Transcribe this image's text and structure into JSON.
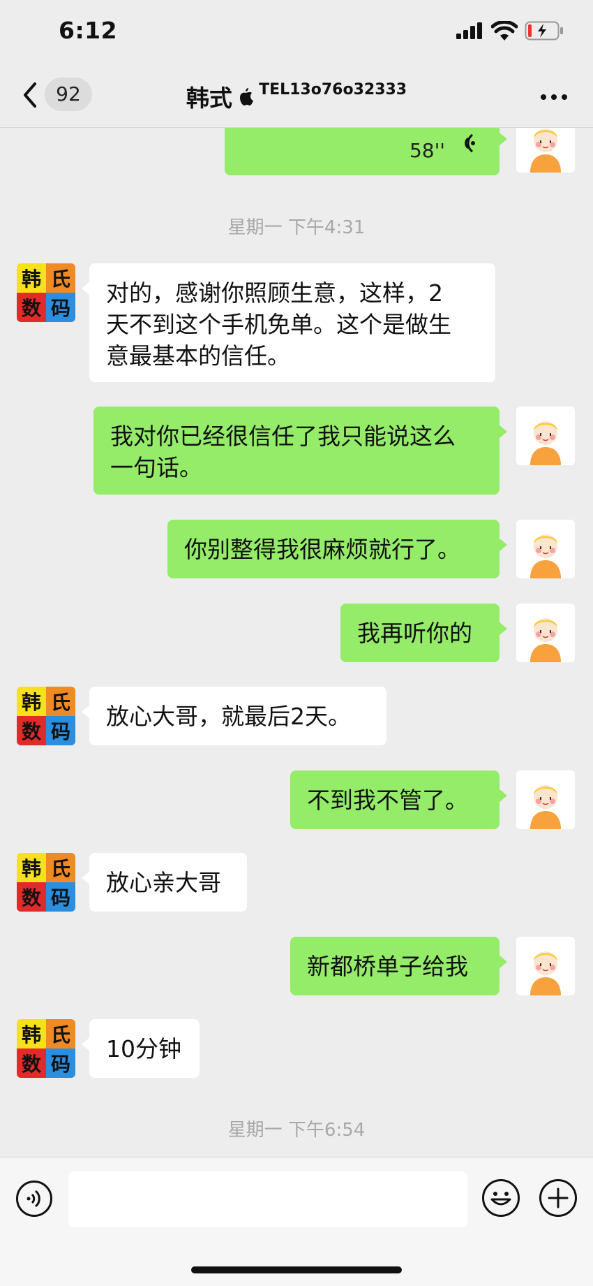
{
  "status_bar": {
    "time": "6:12"
  },
  "nav": {
    "unread_count": "92",
    "contact_name": "韩式",
    "contact_tel": "TEL13o76o32333",
    "back_icon": "chevron-left-icon",
    "more_icon": "more-icon"
  },
  "messages": [
    {
      "type": "voice",
      "from": "me",
      "duration": "58''"
    },
    {
      "type": "timestamp",
      "text": "星期一 下午4:31"
    },
    {
      "type": "text",
      "from": "them",
      "lines": [
        "对的，感谢你照顾生意，这样，2",
        "天不到这个手机免单。这个是做生",
        "意最基本的信任。"
      ]
    },
    {
      "type": "text",
      "from": "me",
      "lines": [
        "我对你已经很信任了我只能说这么",
        "一句话。"
      ]
    },
    {
      "type": "text",
      "from": "me",
      "lines": [
        "你别整得我很麻烦就行了。"
      ]
    },
    {
      "type": "text",
      "from": "me",
      "lines": [
        "我再听你的"
      ]
    },
    {
      "type": "text",
      "from": "them",
      "lines": [
        "放心大哥，就最后2天。"
      ]
    },
    {
      "type": "text",
      "from": "me",
      "lines": [
        "不到我不管了。"
      ]
    },
    {
      "type": "text",
      "from": "them",
      "lines": [
        "放心亲大哥"
      ]
    },
    {
      "type": "text",
      "from": "me",
      "lines": [
        "新都桥单子给我"
      ]
    },
    {
      "type": "text",
      "from": "them",
      "lines": [
        "10分钟"
      ]
    },
    {
      "type": "timestamp",
      "text": "星期一 下午6:54"
    }
  ],
  "contact_avatar": {
    "chars": [
      "韩",
      "氏",
      "数",
      "码"
    ],
    "colors": [
      "#f7e11a",
      "#f08a24",
      "#e22a2a",
      "#2a8fe0"
    ]
  },
  "input": {
    "value": ""
  },
  "colors": {
    "my_bubble": "#95ec69",
    "their_bubble": "#ffffff",
    "background": "#ededed"
  }
}
